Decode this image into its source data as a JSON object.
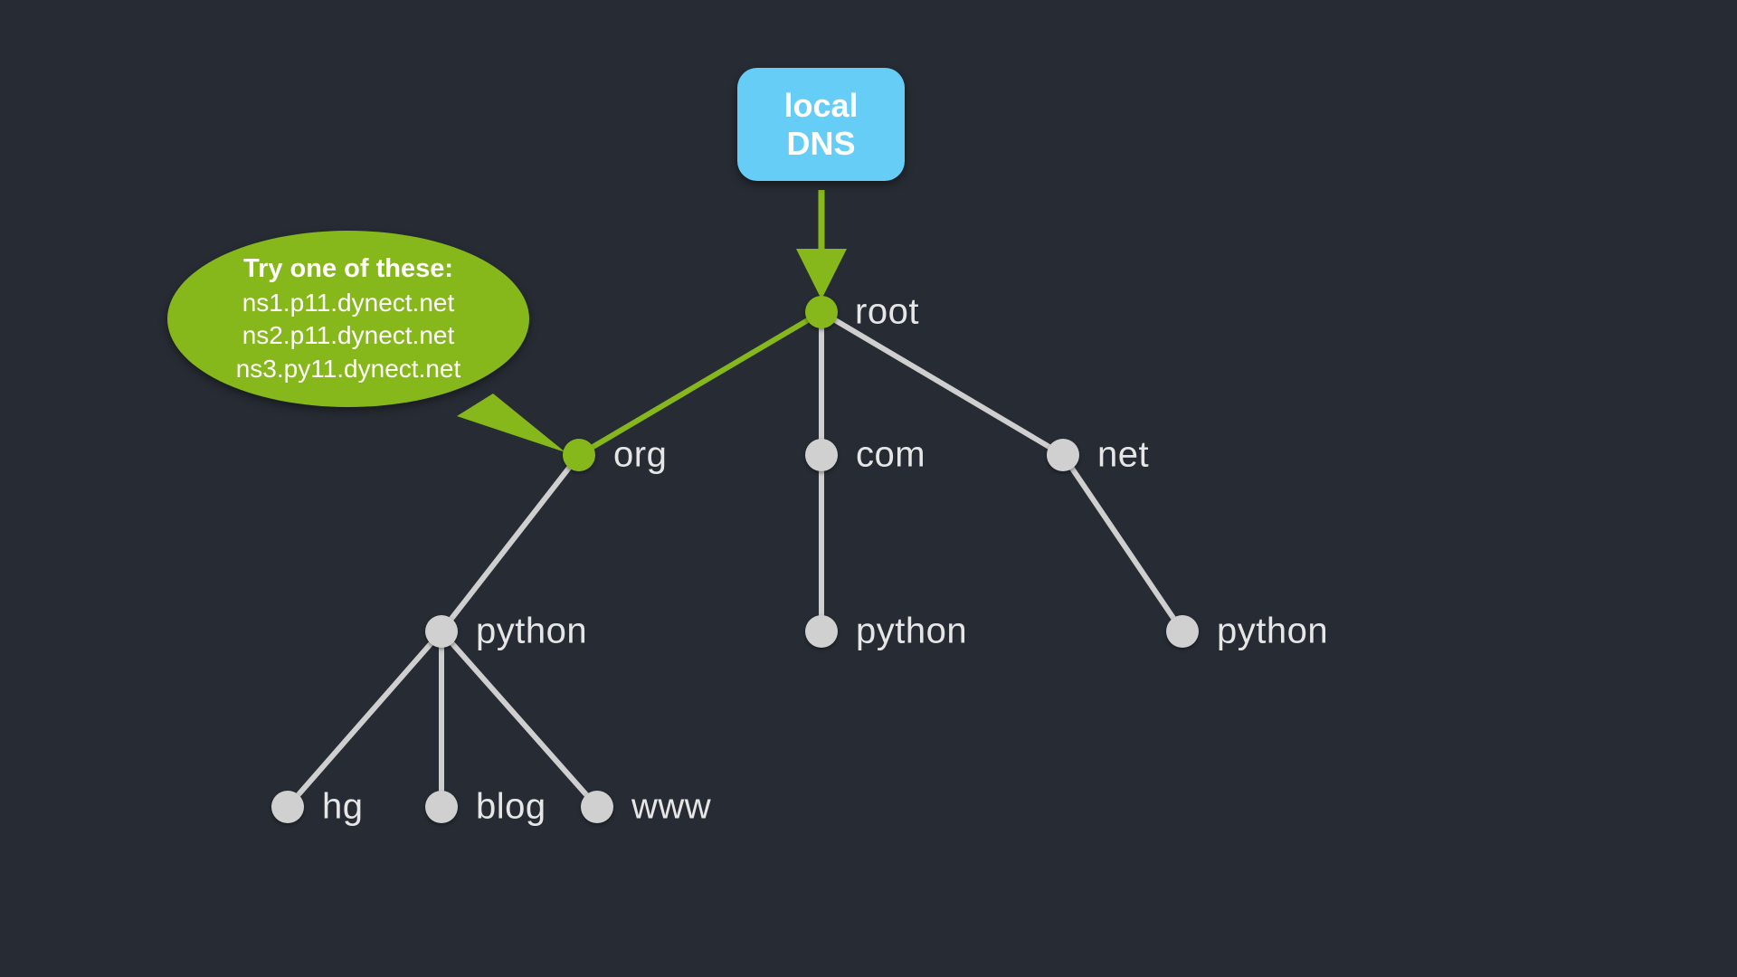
{
  "localdns": {
    "line1": "local",
    "line2": "DNS"
  },
  "bubble": {
    "title": "Try one of these:",
    "lines": [
      "ns1.p11.dynect.net",
      "ns2.p11.dynect.net",
      "ns3.py11.dynect.net"
    ]
  },
  "nodes": {
    "root": {
      "label": "root"
    },
    "org": {
      "label": "org"
    },
    "com": {
      "label": "com"
    },
    "net": {
      "label": "net"
    },
    "python_org": {
      "label": "python"
    },
    "python_com": {
      "label": "python"
    },
    "python_net": {
      "label": "python"
    },
    "hg": {
      "label": "hg"
    },
    "blog": {
      "label": "blog"
    },
    "www": {
      "label": "www"
    }
  }
}
